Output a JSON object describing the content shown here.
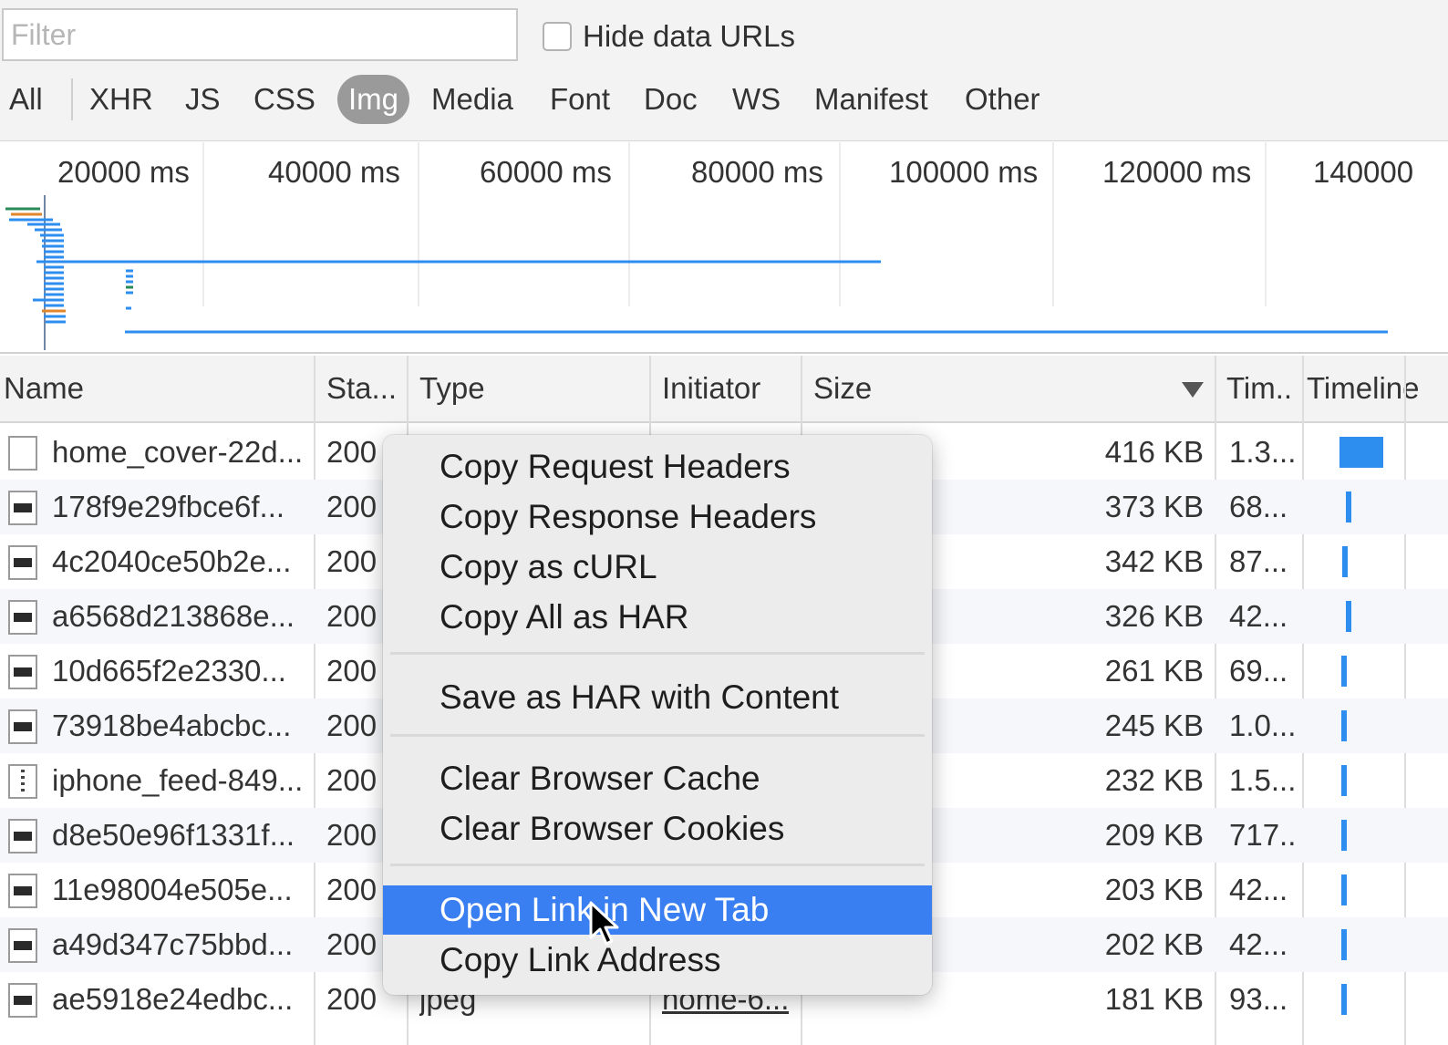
{
  "toolbar": {
    "filter_placeholder": "Filter",
    "hide_data_urls_label": "Hide data URLs",
    "hide_data_urls_checked": false,
    "type_tabs": [
      "All",
      "XHR",
      "JS",
      "CSS",
      "Img",
      "Media",
      "Font",
      "Doc",
      "WS",
      "Manifest",
      "Other"
    ],
    "selected_tab": "Img"
  },
  "overview": {
    "time_labels": [
      "20000 ms",
      "40000 ms",
      "60000 ms",
      "80000 ms",
      "100000 ms",
      "120000 ms",
      "140000"
    ],
    "accent_color": "#2d8ef0"
  },
  "table": {
    "columns": {
      "name": "Name",
      "status": "Sta...",
      "type": "Type",
      "initiator": "Initiator",
      "size": "Size",
      "time": "Tim..",
      "timeline": "Timeline"
    },
    "sorted_column": "Size",
    "sort_direction": "descending",
    "rows": [
      {
        "name": "home_cover-22d...",
        "status": "200",
        "type": "",
        "initiator": "",
        "size": "416 KB",
        "time": "1.3...",
        "icon": "blank-file-icon"
      },
      {
        "name": "178f9e29fbce6f...",
        "status": "200",
        "type": "",
        "initiator": "",
        "size": "373 KB",
        "time": "68...",
        "icon": "image-file-icon"
      },
      {
        "name": "4c2040ce50b2e...",
        "status": "200",
        "type": "",
        "initiator": "",
        "size": "342 KB",
        "time": "87...",
        "icon": "image-file-icon"
      },
      {
        "name": "a6568d213868e...",
        "status": "200",
        "type": "",
        "initiator": "",
        "size": "326 KB",
        "time": "42...",
        "icon": "image-file-icon"
      },
      {
        "name": "10d665f2e2330...",
        "status": "200",
        "type": "",
        "initiator": "",
        "size": "261 KB",
        "time": "69...",
        "icon": "image-file-icon"
      },
      {
        "name": "73918be4abcbc...",
        "status": "200",
        "type": "",
        "initiator": "",
        "size": "245 KB",
        "time": "1.0...",
        "icon": "image-file-icon"
      },
      {
        "name": "iphone_feed-849...",
        "status": "200",
        "type": "",
        "initiator": "",
        "size": "232 KB",
        "time": "1.5...",
        "icon": "dotted-file-icon"
      },
      {
        "name": "d8e50e96f1331f...",
        "status": "200",
        "type": "",
        "initiator": "",
        "size": "209 KB",
        "time": "717...",
        "icon": "image-file-icon"
      },
      {
        "name": "11e98004e505e...",
        "status": "200",
        "type": "",
        "initiator": "",
        "size": "203 KB",
        "time": "42...",
        "icon": "image-file-icon"
      },
      {
        "name": "a49d347c75bbd...",
        "status": "200",
        "type": "",
        "initiator": "",
        "size": "202 KB",
        "time": "42...",
        "icon": "image-file-icon"
      },
      {
        "name": "ae5918e24edbc...",
        "status": "200",
        "type": "jpeg",
        "initiator": "home-6...",
        "size": "181 KB",
        "time": "93...",
        "icon": "image-file-icon"
      }
    ]
  },
  "context_menu": {
    "groups": [
      [
        "Copy Request Headers",
        "Copy Response Headers",
        "Copy as cURL",
        "Copy All as HAR"
      ],
      [
        "Save as HAR with Content"
      ],
      [
        "Clear Browser Cache",
        "Clear Browser Cookies"
      ],
      [
        "Open Link in New Tab",
        "Copy Link Address"
      ]
    ],
    "highlighted_item": "Open Link in New Tab",
    "highlight_color": "#3a7ff2"
  }
}
